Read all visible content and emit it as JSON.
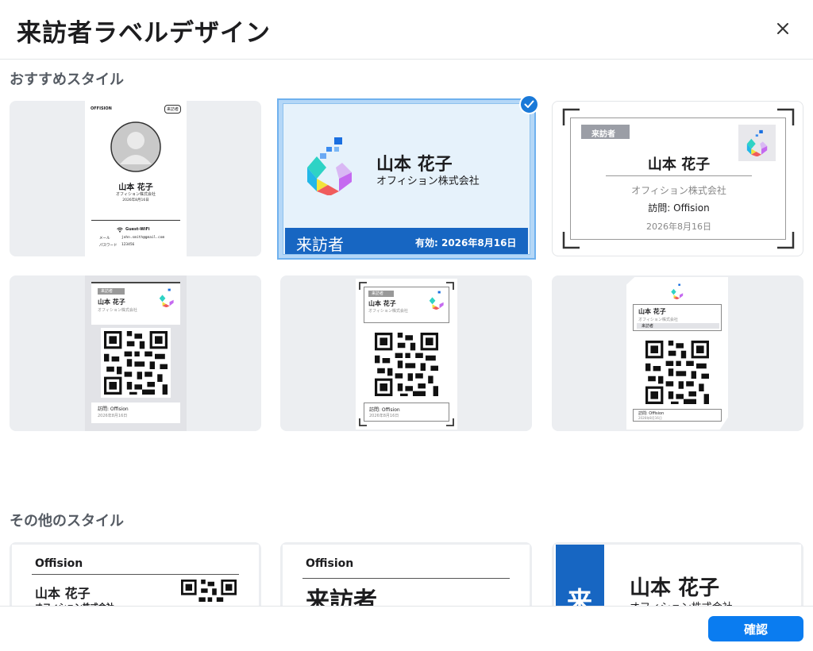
{
  "dialog": {
    "title": "来訪者ラベルデザイン",
    "close_label": "×"
  },
  "sections": {
    "recommended": "おすすめスタイル",
    "other": "その他のスタイル"
  },
  "visitor": {
    "name": "山本 花子",
    "company": "オフィション株式会社",
    "role": "来訪者",
    "visit": "訪問: Offision",
    "date": "2026年8月16日",
    "valid": "有効: 2026年8月16日",
    "brand": "Offision",
    "brand_upper": "OFFISION",
    "wifi": "Guest-WiFi",
    "mail_label": "メール",
    "mail_value": "john.smith@gmail.com",
    "pass_label": "パスワード",
    "pass_value": "123456"
  },
  "footer": {
    "confirm": "確認"
  },
  "colors": {
    "accent": "#0a7cf0",
    "selected_bg": "#e6f2fb",
    "banner": "#1766c2",
    "card_bg": "#eceef1"
  }
}
